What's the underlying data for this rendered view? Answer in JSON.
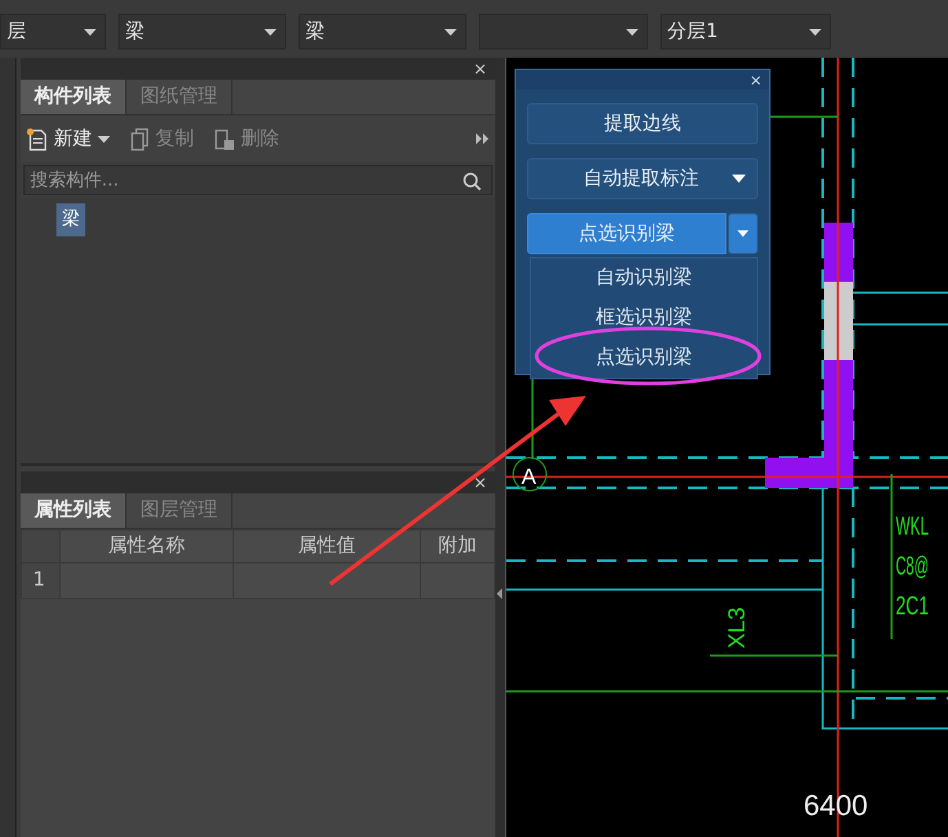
{
  "toolbar": {
    "dropdowns": [
      {
        "kind": "combo",
        "value": "层"
      },
      {
        "kind": "combo",
        "value": "梁"
      },
      {
        "kind": "combo",
        "value": "梁"
      },
      {
        "kind": "combo"
      },
      {
        "kind": "combo",
        "value": "分层1"
      }
    ]
  },
  "close_glyph": [
    "×",
    "×",
    "×"
  ],
  "component_panel": {
    "tabs": [
      {
        "label": "构件列表",
        "selected": true
      },
      {
        "label": "图纸管理",
        "selected": false
      }
    ],
    "actions": [
      {
        "label": "新建",
        "disabled": false,
        "menu": true
      },
      {
        "label": "复制",
        "disabled": true
      },
      {
        "label": "删除",
        "disabled": true
      }
    ],
    "search": {
      "placeholder": "搜索构件..."
    },
    "tree": [
      {
        "label": "梁",
        "selected": true
      }
    ]
  },
  "property_panel": {
    "tabs": [
      {
        "label": "属性列表",
        "selected": true
      },
      {
        "label": "图层管理",
        "selected": false
      }
    ],
    "table": {
      "columns": [
        "属性名称",
        "属性值",
        "附加"
      ],
      "rows": [
        {
          "index": "1"
        }
      ]
    }
  },
  "dialog": {
    "buttons": [
      {
        "kind": "button",
        "label": "提取边线",
        "active": false
      },
      {
        "kind": "split",
        "label": "自动提取标注",
        "active": false
      },
      {
        "kind": "split",
        "label": "点选识别梁",
        "active": true
      }
    ],
    "menu": [
      {
        "label": "自动识别梁",
        "circled": false
      },
      {
        "label": "框选识别梁",
        "circled": false
      },
      {
        "label": "点选识别梁",
        "circled": true
      }
    ]
  },
  "drawing": {
    "axis_label": "A",
    "dimension": "6400",
    "beam_note": [
      "WKL",
      "C8@",
      "2C1"
    ],
    "beam_label": "XL3"
  }
}
